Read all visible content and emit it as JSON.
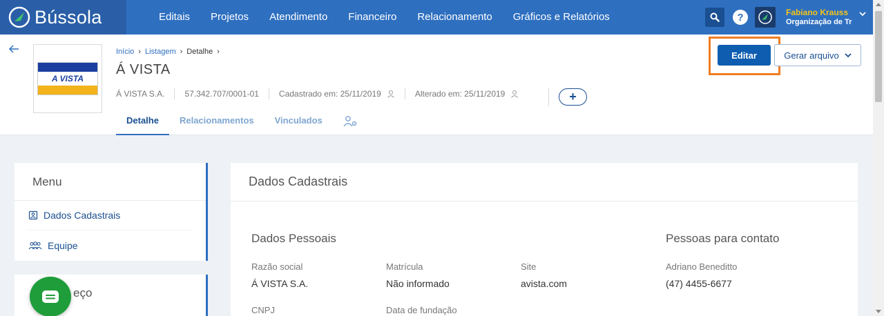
{
  "app": {
    "name": "Bússola"
  },
  "nav": {
    "items": [
      "Editais",
      "Projetos",
      "Atendimento",
      "Financeiro",
      "Relacionamento",
      "Gráficos e Relatórios"
    ]
  },
  "user": {
    "name": "Fabiano Krauss",
    "org": "Organização de Tre"
  },
  "breadcrumb": {
    "home": "Início",
    "list": "Listagem",
    "current": "Detalhe"
  },
  "company": {
    "title": "Á VISTA",
    "logo_text": "A VISTA",
    "name": "Á VISTA S.A.",
    "cnpj": "57.342.707/0001-01",
    "created": "Cadastrado em: 25/11/2019",
    "updated": "Alterado em: 25/11/2019"
  },
  "tabs": [
    "Detalhe",
    "Relacionamentos",
    "Vinculados"
  ],
  "actions": {
    "edit_label": "Editar",
    "generate_label": "Gerar arquivo",
    "add_label": "+"
  },
  "menu": {
    "title": "Menu",
    "items": [
      "Dados Cadastrais",
      "Equipe"
    ],
    "address_title_partial": "eço"
  },
  "main": {
    "title": "Dados Cadastrais",
    "personal_title": "Dados Pessoais",
    "contacts_title": "Pessoas para contato",
    "fields": {
      "razao_label": "Razão social",
      "razao_value": "Á VISTA S.A.",
      "matricula_label": "Matrícula",
      "matricula_value": "Não informado",
      "site_label": "Site",
      "site_value": "avista.com",
      "cnpj_label": "CNPJ",
      "fundacao_label": "Data de fundação"
    },
    "contact": {
      "name": "Adriano Beneditto",
      "phone": "(47) 4455-6677"
    }
  },
  "colors": {
    "primary": "#2e6fc0",
    "dark_primary": "#0f5db0",
    "highlight": "#f07d22",
    "chat": "#1e9d3a"
  }
}
